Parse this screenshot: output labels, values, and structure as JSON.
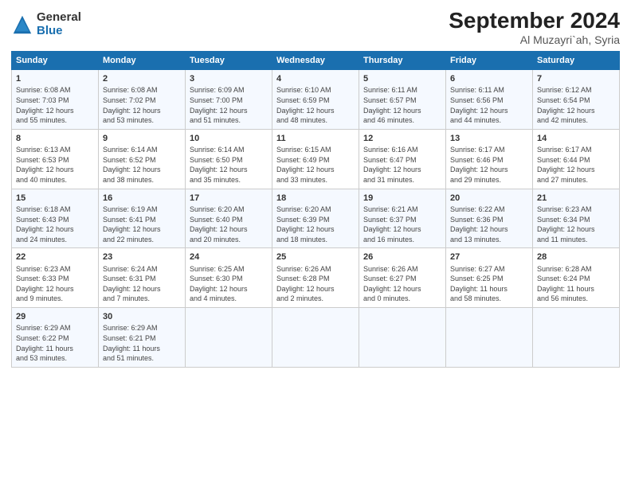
{
  "logo": {
    "general": "General",
    "blue": "Blue"
  },
  "title": "September 2024",
  "subtitle": "Al Muzayri`ah, Syria",
  "headers": [
    "Sunday",
    "Monday",
    "Tuesday",
    "Wednesday",
    "Thursday",
    "Friday",
    "Saturday"
  ],
  "weeks": [
    [
      {
        "day": "1",
        "info": "Sunrise: 6:08 AM\nSunset: 7:03 PM\nDaylight: 12 hours\nand 55 minutes."
      },
      {
        "day": "2",
        "info": "Sunrise: 6:08 AM\nSunset: 7:02 PM\nDaylight: 12 hours\nand 53 minutes."
      },
      {
        "day": "3",
        "info": "Sunrise: 6:09 AM\nSunset: 7:00 PM\nDaylight: 12 hours\nand 51 minutes."
      },
      {
        "day": "4",
        "info": "Sunrise: 6:10 AM\nSunset: 6:59 PM\nDaylight: 12 hours\nand 48 minutes."
      },
      {
        "day": "5",
        "info": "Sunrise: 6:11 AM\nSunset: 6:57 PM\nDaylight: 12 hours\nand 46 minutes."
      },
      {
        "day": "6",
        "info": "Sunrise: 6:11 AM\nSunset: 6:56 PM\nDaylight: 12 hours\nand 44 minutes."
      },
      {
        "day": "7",
        "info": "Sunrise: 6:12 AM\nSunset: 6:54 PM\nDaylight: 12 hours\nand 42 minutes."
      }
    ],
    [
      {
        "day": "8",
        "info": "Sunrise: 6:13 AM\nSunset: 6:53 PM\nDaylight: 12 hours\nand 40 minutes."
      },
      {
        "day": "9",
        "info": "Sunrise: 6:14 AM\nSunset: 6:52 PM\nDaylight: 12 hours\nand 38 minutes."
      },
      {
        "day": "10",
        "info": "Sunrise: 6:14 AM\nSunset: 6:50 PM\nDaylight: 12 hours\nand 35 minutes."
      },
      {
        "day": "11",
        "info": "Sunrise: 6:15 AM\nSunset: 6:49 PM\nDaylight: 12 hours\nand 33 minutes."
      },
      {
        "day": "12",
        "info": "Sunrise: 6:16 AM\nSunset: 6:47 PM\nDaylight: 12 hours\nand 31 minutes."
      },
      {
        "day": "13",
        "info": "Sunrise: 6:17 AM\nSunset: 6:46 PM\nDaylight: 12 hours\nand 29 minutes."
      },
      {
        "day": "14",
        "info": "Sunrise: 6:17 AM\nSunset: 6:44 PM\nDaylight: 12 hours\nand 27 minutes."
      }
    ],
    [
      {
        "day": "15",
        "info": "Sunrise: 6:18 AM\nSunset: 6:43 PM\nDaylight: 12 hours\nand 24 minutes."
      },
      {
        "day": "16",
        "info": "Sunrise: 6:19 AM\nSunset: 6:41 PM\nDaylight: 12 hours\nand 22 minutes."
      },
      {
        "day": "17",
        "info": "Sunrise: 6:20 AM\nSunset: 6:40 PM\nDaylight: 12 hours\nand 20 minutes."
      },
      {
        "day": "18",
        "info": "Sunrise: 6:20 AM\nSunset: 6:39 PM\nDaylight: 12 hours\nand 18 minutes."
      },
      {
        "day": "19",
        "info": "Sunrise: 6:21 AM\nSunset: 6:37 PM\nDaylight: 12 hours\nand 16 minutes."
      },
      {
        "day": "20",
        "info": "Sunrise: 6:22 AM\nSunset: 6:36 PM\nDaylight: 12 hours\nand 13 minutes."
      },
      {
        "day": "21",
        "info": "Sunrise: 6:23 AM\nSunset: 6:34 PM\nDaylight: 12 hours\nand 11 minutes."
      }
    ],
    [
      {
        "day": "22",
        "info": "Sunrise: 6:23 AM\nSunset: 6:33 PM\nDaylight: 12 hours\nand 9 minutes."
      },
      {
        "day": "23",
        "info": "Sunrise: 6:24 AM\nSunset: 6:31 PM\nDaylight: 12 hours\nand 7 minutes."
      },
      {
        "day": "24",
        "info": "Sunrise: 6:25 AM\nSunset: 6:30 PM\nDaylight: 12 hours\nand 4 minutes."
      },
      {
        "day": "25",
        "info": "Sunrise: 6:26 AM\nSunset: 6:28 PM\nDaylight: 12 hours\nand 2 minutes."
      },
      {
        "day": "26",
        "info": "Sunrise: 6:26 AM\nSunset: 6:27 PM\nDaylight: 12 hours\nand 0 minutes."
      },
      {
        "day": "27",
        "info": "Sunrise: 6:27 AM\nSunset: 6:25 PM\nDaylight: 11 hours\nand 58 minutes."
      },
      {
        "day": "28",
        "info": "Sunrise: 6:28 AM\nSunset: 6:24 PM\nDaylight: 11 hours\nand 56 minutes."
      }
    ],
    [
      {
        "day": "29",
        "info": "Sunrise: 6:29 AM\nSunset: 6:22 PM\nDaylight: 11 hours\nand 53 minutes."
      },
      {
        "day": "30",
        "info": "Sunrise: 6:29 AM\nSunset: 6:21 PM\nDaylight: 11 hours\nand 51 minutes."
      },
      {
        "day": "",
        "info": ""
      },
      {
        "day": "",
        "info": ""
      },
      {
        "day": "",
        "info": ""
      },
      {
        "day": "",
        "info": ""
      },
      {
        "day": "",
        "info": ""
      }
    ]
  ]
}
